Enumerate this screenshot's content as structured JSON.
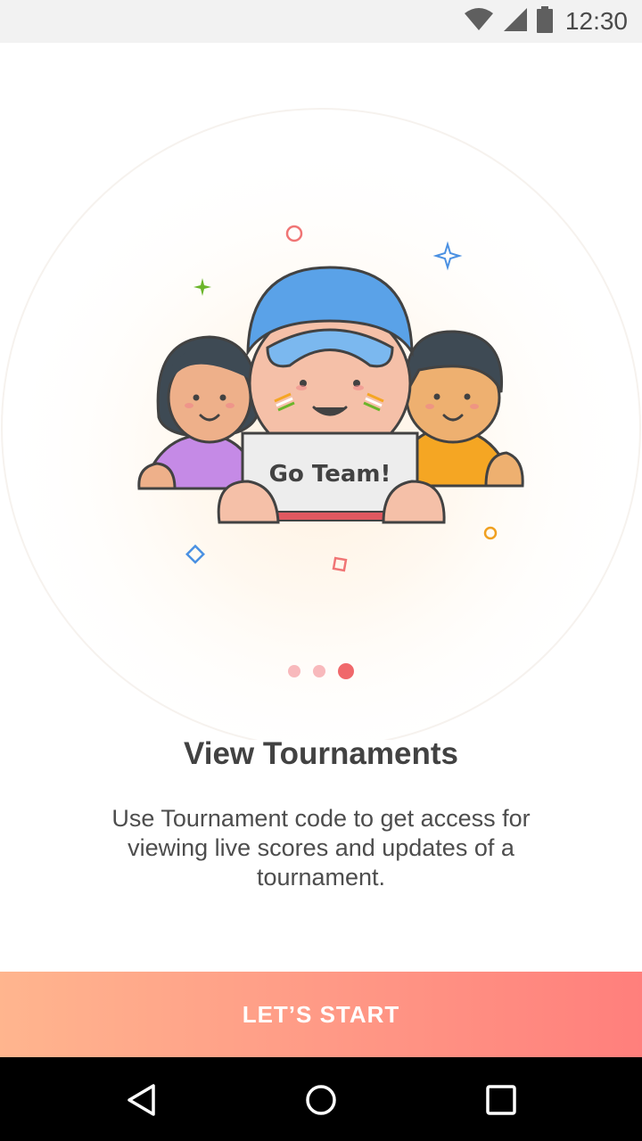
{
  "status_bar": {
    "time": "12:30",
    "icons": [
      "wifi-icon",
      "signal-icon",
      "battery-icon"
    ]
  },
  "illustration": {
    "sign_text": "Go Team!"
  },
  "pager": {
    "count": 3,
    "active_index": 2
  },
  "content": {
    "title": "View Tournaments",
    "description": "Use Tournament code to get access for viewing live scores and updates of a tournament."
  },
  "cta": {
    "label": "LET’S START"
  },
  "nav": {
    "icons": [
      "back-icon",
      "home-icon",
      "recents-icon"
    ]
  },
  "colors": {
    "accent": "#f0686b",
    "dot_inactive": "#f8b9bc",
    "gradient_start": "#ffb58e",
    "gradient_end": "#ff7f7c"
  }
}
